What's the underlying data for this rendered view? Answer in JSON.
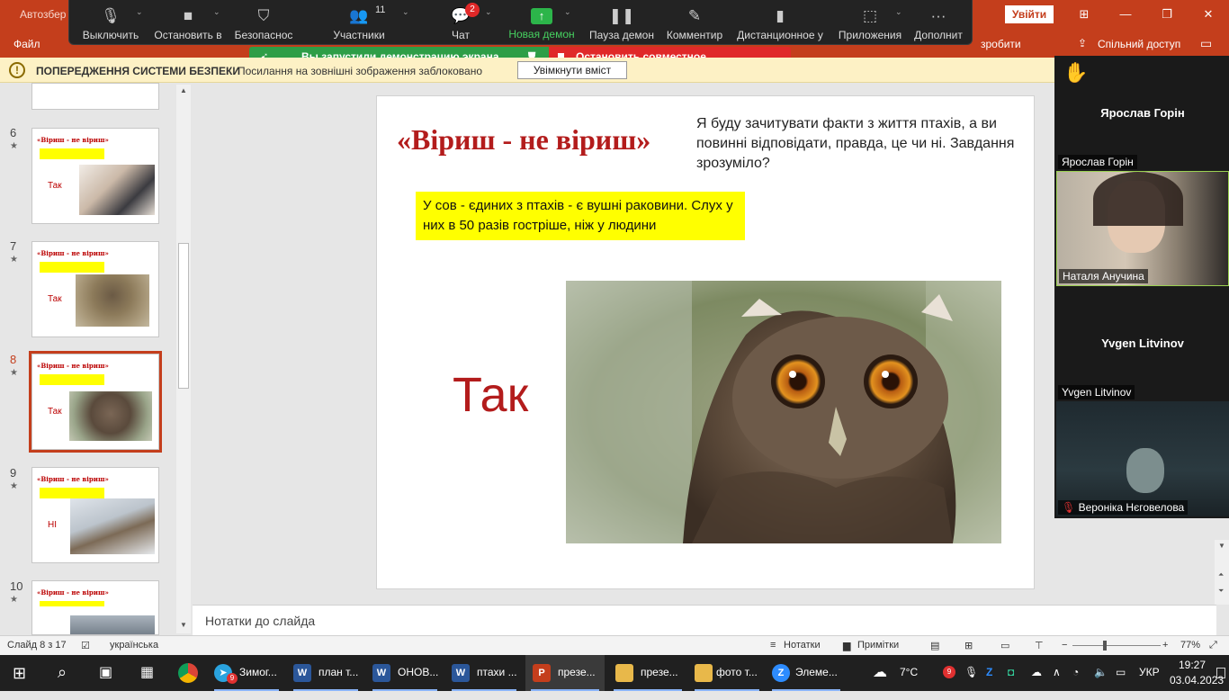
{
  "powerpoint": {
    "app_title": "Автозбер",
    "login_label": "Увійти",
    "tabs": [
      "Файл"
    ],
    "tell_me": "зробити",
    "share_label": "Спільний доступ"
  },
  "zoom_toolbar": {
    "mute": "Выключить",
    "stop_video": "Остановить в",
    "security": "Безопаснос",
    "participants": "Участники",
    "participants_count": "11",
    "chat": "Чат",
    "chat_badge": "2",
    "new_share": "Новая демон",
    "pause_share": "Пауза демон",
    "annotate": "Комментир",
    "remote_control": "Дистанционное у",
    "apps": "Приложения",
    "more": "Дополнит"
  },
  "sharing": {
    "status": "Вы запустили демонстрацию экрана",
    "stop": "Остановить совместное использование"
  },
  "security_bar": {
    "title": "ПОПЕРЕДЖЕННЯ СИСТЕМИ БЕЗПЕКИ",
    "message": "Посилання на зовнішні зображення заблоковано",
    "enable_button": "Увімкнути вміст"
  },
  "thumbnails": [
    {
      "num": "6",
      "answer": "Так",
      "title": "«Віриш - не віриш»"
    },
    {
      "num": "7",
      "answer": "Так",
      "title": "«Віриш - не віриш»"
    },
    {
      "num": "8",
      "answer": "Так",
      "title": "«Віриш - не віриш»"
    },
    {
      "num": "9",
      "answer": "НІ",
      "title": "«Віриш - не віриш»"
    },
    {
      "num": "10",
      "answer": "",
      "title": "«Віриш - не віриш»"
    }
  ],
  "slide": {
    "title": "«Віриш - не віриш»",
    "intro": "Я буду зачитувати факти з життя птахів, а ви повинні відповідати, правда, це чи ні. Завдання зрозуміло?",
    "fact": "У сов - єдиних з птахів - є вушні раковини. Слух у них в 50 разів гостріше, ніж у людини",
    "answer": "Так"
  },
  "notes_placeholder": "Нотатки до слайда",
  "status_bar": {
    "slide_of": "Слайд 8 з 17",
    "language": "українська",
    "notes": "Нотатки",
    "comments": "Примітки",
    "zoom": "77%"
  },
  "video_panel": [
    {
      "name": "Ярослав Горін",
      "label": "Ярослав Горін",
      "type": "name"
    },
    {
      "name": "",
      "label": "Наталя Анучина",
      "type": "video"
    },
    {
      "name": "Yvgen Litvinov",
      "label": "Yvgen Litvinov",
      "type": "name"
    },
    {
      "name": "",
      "label": "Вероніка Нєговелова",
      "type": "video"
    }
  ],
  "taskbar": {
    "apps": [
      {
        "label": "Зимог...",
        "badge": "9"
      },
      {
        "label": "план т..."
      },
      {
        "label": "ОНОВ..."
      },
      {
        "label": "птахи ..."
      },
      {
        "label": "презе..."
      },
      {
        "label": "презе..."
      },
      {
        "label": "фото т..."
      },
      {
        "label": "Элеме..."
      }
    ],
    "weather": "7°C",
    "tray_badge": "9",
    "language": "УКР",
    "time": "19:27",
    "date": "03.04.2023"
  }
}
